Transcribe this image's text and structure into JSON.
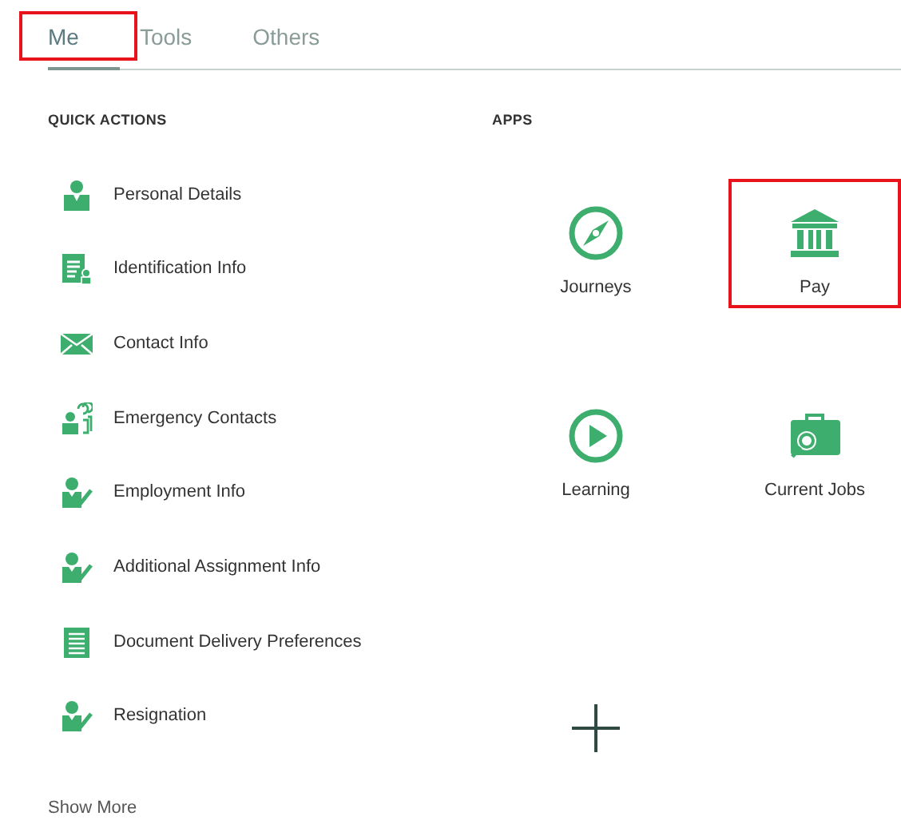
{
  "tabs": [
    {
      "label": "Me",
      "selected": true,
      "highlighted": true
    },
    {
      "label": "Tools",
      "selected": false,
      "highlighted": false
    },
    {
      "label": "Others",
      "selected": false,
      "highlighted": false
    }
  ],
  "quick_actions": {
    "title": "QUICK ACTIONS",
    "items": [
      {
        "kind": "person",
        "label": "Personal Details"
      },
      {
        "kind": "id-card",
        "label": "Identification Info"
      },
      {
        "kind": "envelope",
        "label": "Contact Info"
      },
      {
        "kind": "group",
        "label": "Emergency Contacts"
      },
      {
        "kind": "person-edit",
        "label": "Employment Info"
      },
      {
        "kind": "person-edit",
        "label": "Additional Assignment Info"
      },
      {
        "kind": "document",
        "label": "Document Delivery Preferences"
      },
      {
        "kind": "person-edit",
        "label": "Resignation"
      }
    ],
    "show_more": "Show More"
  },
  "apps": {
    "title": "APPS",
    "items": [
      {
        "kind": "compass",
        "label": "Journeys",
        "highlighted": false
      },
      {
        "kind": "bank",
        "label": "Pay",
        "highlighted": true
      },
      {
        "kind": "play",
        "label": "Learning",
        "highlighted": false
      },
      {
        "kind": "briefcase",
        "label": "Current Jobs",
        "highlighted": false
      },
      {
        "kind": "add",
        "highlighted": false
      }
    ]
  }
}
